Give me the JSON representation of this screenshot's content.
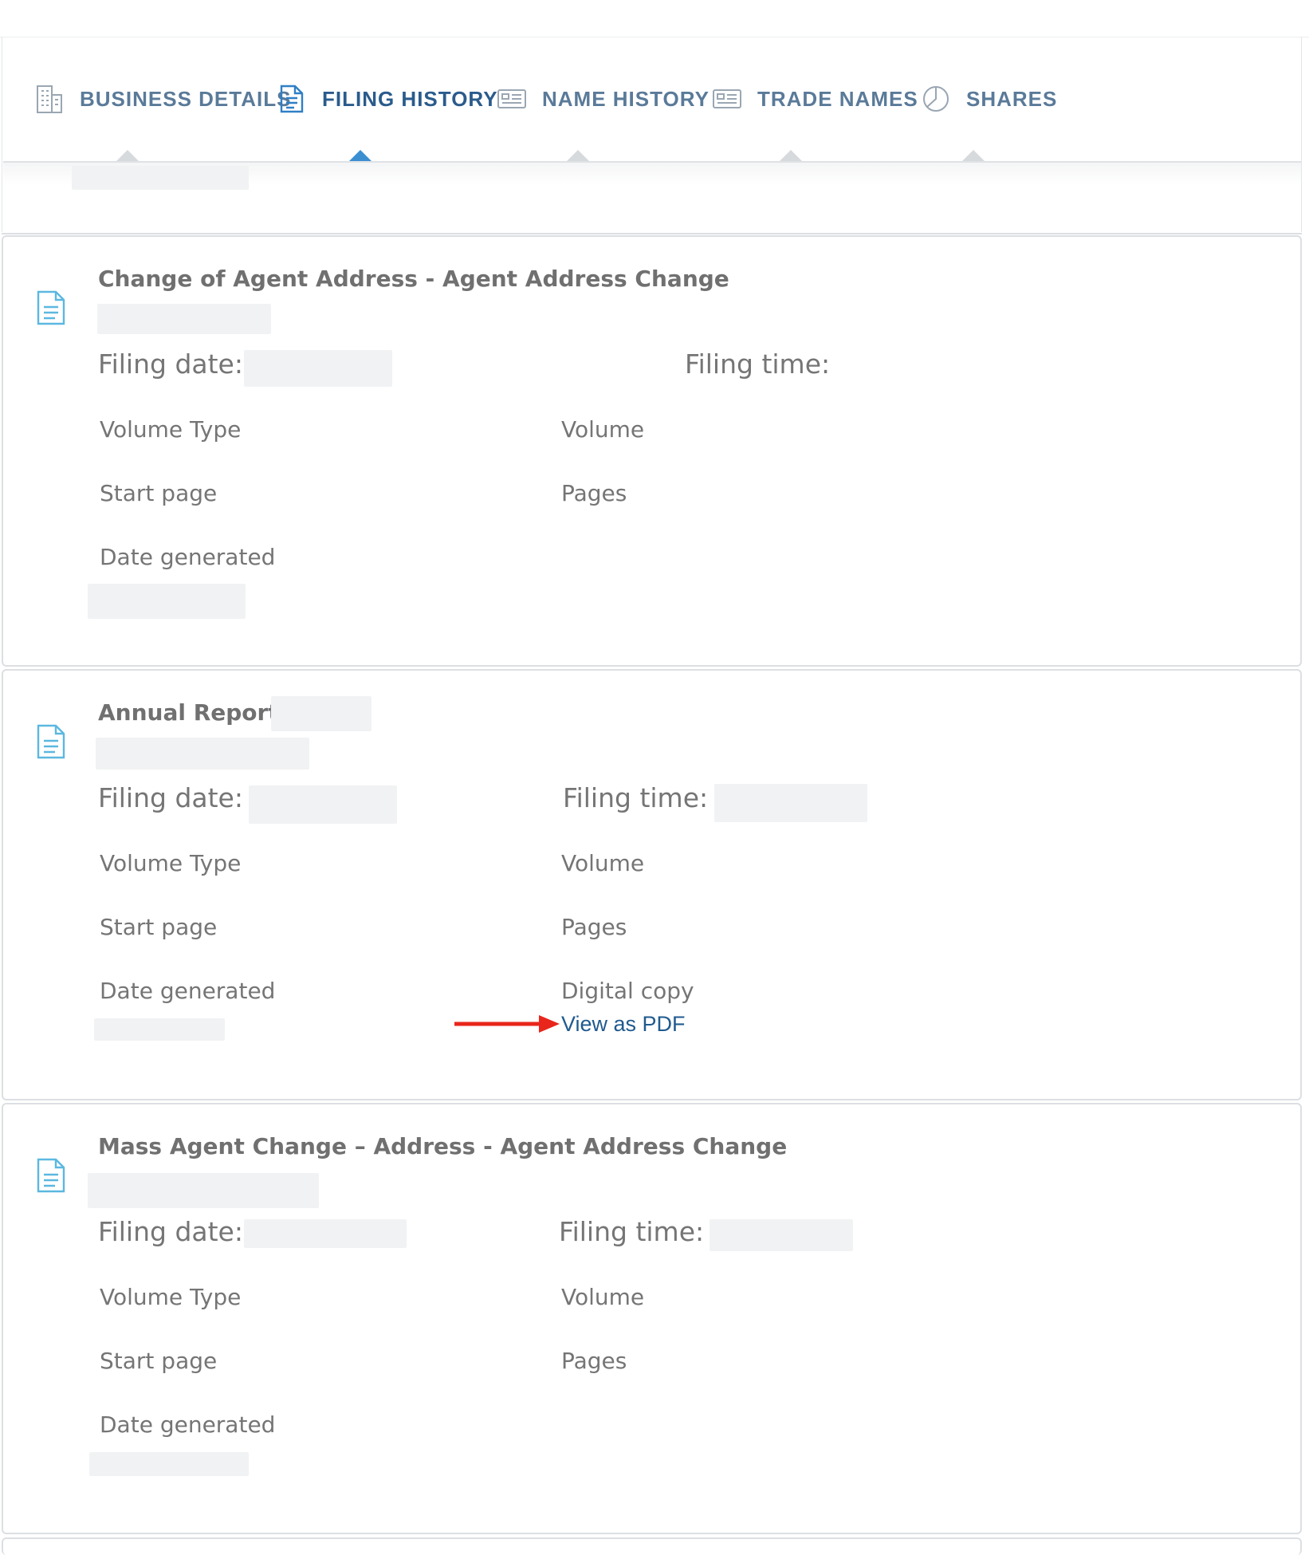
{
  "tabs": [
    {
      "label": "BUSINESS DETAILS",
      "icon": "building-icon",
      "active": false
    },
    {
      "label": "FILING HISTORY",
      "icon": "document-icon",
      "active": true
    },
    {
      "label": "NAME HISTORY",
      "icon": "id-card-icon",
      "active": false
    },
    {
      "label": "TRADE NAMES",
      "icon": "id-card-icon",
      "active": false
    },
    {
      "label": "SHARES",
      "icon": "pie-chart-icon",
      "active": false
    }
  ],
  "filings": [
    {
      "title": "Change of Agent Address - Agent Address Change",
      "filing_date_label": "Filing date:",
      "filing_time_label": "Filing time:",
      "volume_type_label": "Volume Type",
      "volume_label": "Volume",
      "start_page_label": "Start page",
      "pages_label": "Pages",
      "date_generated_label": "Date generated"
    },
    {
      "title": "Annual Report",
      "filing_date_label": "Filing date:",
      "filing_time_label": "Filing time:",
      "volume_type_label": "Volume Type",
      "volume_label": "Volume",
      "start_page_label": "Start page",
      "pages_label": "Pages",
      "date_generated_label": "Date generated",
      "digital_copy_label": "Digital copy",
      "pdf_link": "View as PDF"
    },
    {
      "title": "Mass Agent Change – Address - Agent Address Change",
      "filing_date_label": "Filing date:",
      "filing_time_label": "Filing time:",
      "volume_type_label": "Volume Type",
      "volume_label": "Volume",
      "start_page_label": "Start page",
      "pages_label": "Pages",
      "date_generated_label": "Date generated"
    }
  ],
  "colors": {
    "tab_text": "#5a7a99",
    "tab_active": "#2a5b8c",
    "caret_active": "#3b8fd1",
    "link": "#1f5a8e",
    "annotation_arrow": "#e8261b",
    "doc_icon": "#5bb8e0"
  }
}
